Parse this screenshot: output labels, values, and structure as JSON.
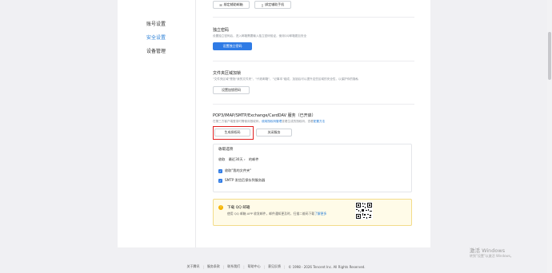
{
  "sidebar": {
    "items": [
      {
        "label": "账号设置",
        "active": false
      },
      {
        "label": "安全设置",
        "active": true
      },
      {
        "label": "设备管理",
        "active": false
      }
    ]
  },
  "top_buttons": {
    "bind_email": "绑定辅助邮箱",
    "bind_phone": "绑定辅助手机"
  },
  "independent_password": {
    "title": "独立密码",
    "desc": "设置独立密码后，进入邮箱需要输入独立密码验证，使用QQ邮箱更加安全",
    "button": "设置独立密码"
  },
  "folder_lock": {
    "title": "文件夹区域加锁",
    "desc": "\"文件夹区域\"是指\"我的文件夹\"、\"代收邮箱\"、\"记事本\"组成，加锁后可以提升这些区域的安全性，以保护你的隐私",
    "button": "设置加锁密码"
  },
  "pop3": {
    "title": "POP3/IMAP/SMTP/Exchange/CardDAV 服务（已开启）",
    "desc_prefix": "在第三方客户端登录时需使用授权码，",
    "desc_link1": "使用授权码管理",
    "desc_mid": "查看生成的授权码，查看",
    "desc_link2": "配置方法",
    "generate_button": "生成授权码",
    "close_button": "关闭服务"
  },
  "receive": {
    "title": "收取选项",
    "line_label": "收取",
    "range_value": "最近30天",
    "line_suffix": "的邮件",
    "option1": "收取\"我的文件夹\"",
    "option2": "SMTP 发信后保存到服务器"
  },
  "download": {
    "title": "下载 QQ 邮箱",
    "desc": "使用 QQ 邮箱 APP 收发邮件，邮件通知更及时，扫描二维码下载",
    "link": "了解更多"
  },
  "footer": {
    "links": [
      "关于腾讯",
      "服务条款",
      "联系我们",
      "帮助中心",
      "意见反馈"
    ],
    "copyright": "© 1998 - 2026 Tencent Inc. All Rights Reserved."
  },
  "activation": {
    "title": "激活 Windows",
    "subtitle": "转到\"设置\"以激活 Windows。"
  },
  "colors": {
    "accent": "#2f7be5",
    "highlight": "#e02020",
    "warning_bg": "#fffbe8"
  }
}
